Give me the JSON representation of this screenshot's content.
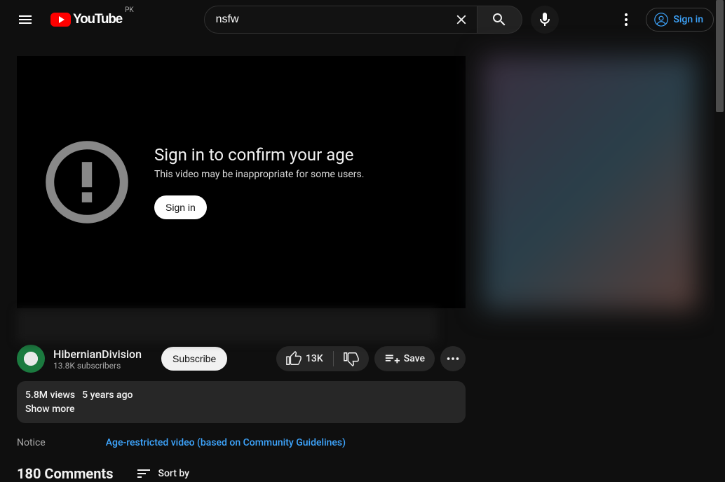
{
  "header": {
    "country_code": "PK",
    "search_value": "nsfw",
    "signin_label": "Sign in"
  },
  "player": {
    "age_gate_title": "Sign in to confirm your age",
    "age_gate_subtitle": "This video may be inappropriate for some users.",
    "signin_button": "Sign in"
  },
  "video": {
    "channel_name": "HibernianDivision",
    "subscriber_count": "13.8K subscribers",
    "subscribe_label": "Subscribe",
    "like_count": "13K",
    "save_label": "Save",
    "views": "5.8M views",
    "upload_age": "5 years ago",
    "show_more": "Show more"
  },
  "notice": {
    "label": "Notice",
    "link_text": "Age-restricted video (based on Community Guidelines)"
  },
  "comments": {
    "count_label": "180 Comments",
    "sort_label": "Sort by"
  }
}
